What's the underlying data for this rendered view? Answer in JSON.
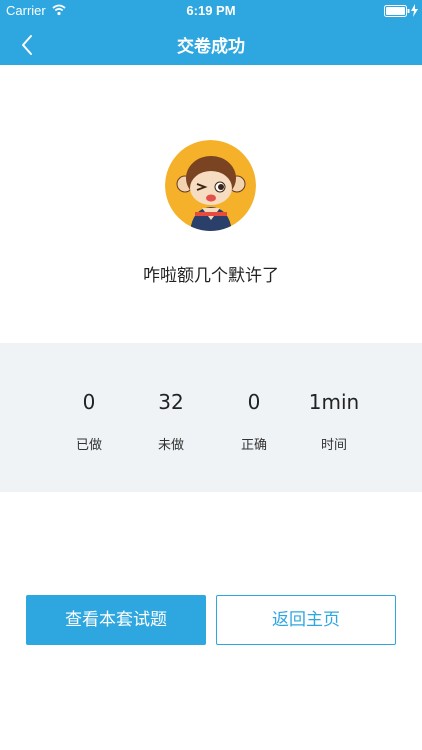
{
  "status_bar": {
    "carrier": "Carrier",
    "time": "6:19 PM",
    "wifi_icon": "wifi-icon",
    "battery_icon": "battery-icon",
    "charging_icon": "bolt-icon"
  },
  "nav": {
    "back_icon": "chevron-left-icon",
    "title": "交卷成功"
  },
  "result": {
    "avatar": "monkey-avatar",
    "message": "咋啦额几个默许了"
  },
  "stats": [
    {
      "value": "0",
      "label": "已做"
    },
    {
      "value": "32",
      "label": "未做"
    },
    {
      "value": "0",
      "label": "正确"
    },
    {
      "value": "1min",
      "label": "时间"
    }
  ],
  "actions": {
    "view_questions_label": "查看本套试题",
    "back_home_label": "返回主页"
  },
  "colors": {
    "accent": "#2ea7e0",
    "panel_background": "#f0f3f6",
    "avatar_background": "#f5b12a"
  }
}
